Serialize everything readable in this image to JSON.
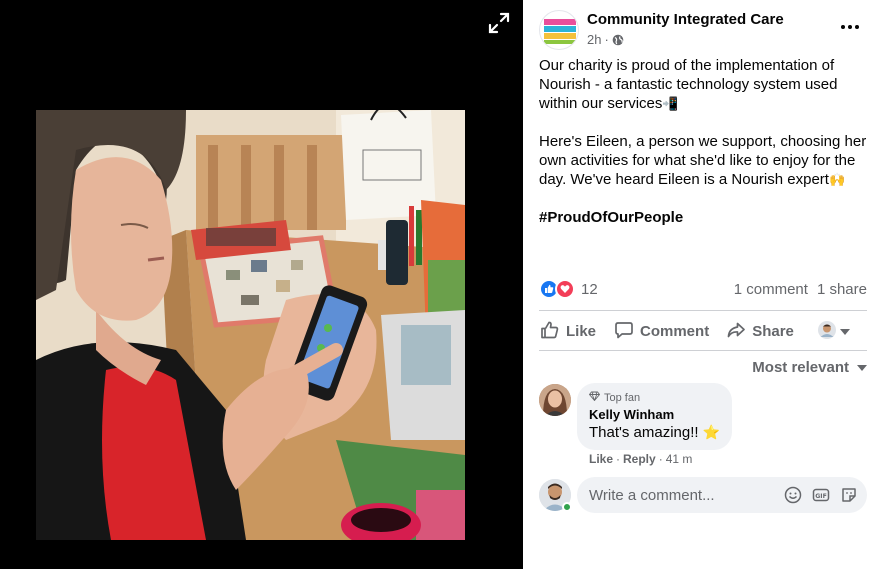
{
  "viewer": {
    "expand_icon": "expand-arrows-icon",
    "photo_label": "Photo of Eileen using the Nourish app on a smartphone"
  },
  "post": {
    "page_name": "Community Integrated Care",
    "timestamp": "2h",
    "separator": "·",
    "audience_icon": "globe-icon",
    "paragraphs": [
      "Our charity is proud of the implementation of Nourish - a fantastic technology system used within our services",
      "Here's Eileen, a person we support, choosing her own activities for what she'd like to enjoy for the day. We've heard Eileen is a Nourish expert"
    ],
    "emoji_1": "📲",
    "emoji_2": "🙌",
    "hashtag": "#ProudOfOurPeople",
    "reaction_count": "12",
    "comments_count": "1 comment",
    "shares_count": "1 share"
  },
  "actions": {
    "like": "Like",
    "comment": "Comment",
    "share": "Share"
  },
  "comments": {
    "sort_label": "Most relevant",
    "items": [
      {
        "badge": "Top fan",
        "author": "Kelly Winham",
        "text": "That's amazing!!",
        "emoji": "⭐",
        "like": "Like",
        "separator": "·",
        "reply": "Reply",
        "separator2": "·",
        "time": "41 m"
      }
    ]
  },
  "composer": {
    "placeholder": "Write a comment..."
  },
  "colors": {
    "accent": "#1877f2",
    "love": "#f33e58",
    "secondary_text": "#65676b",
    "bubble": "#f0f2f5",
    "online": "#31a24c"
  }
}
